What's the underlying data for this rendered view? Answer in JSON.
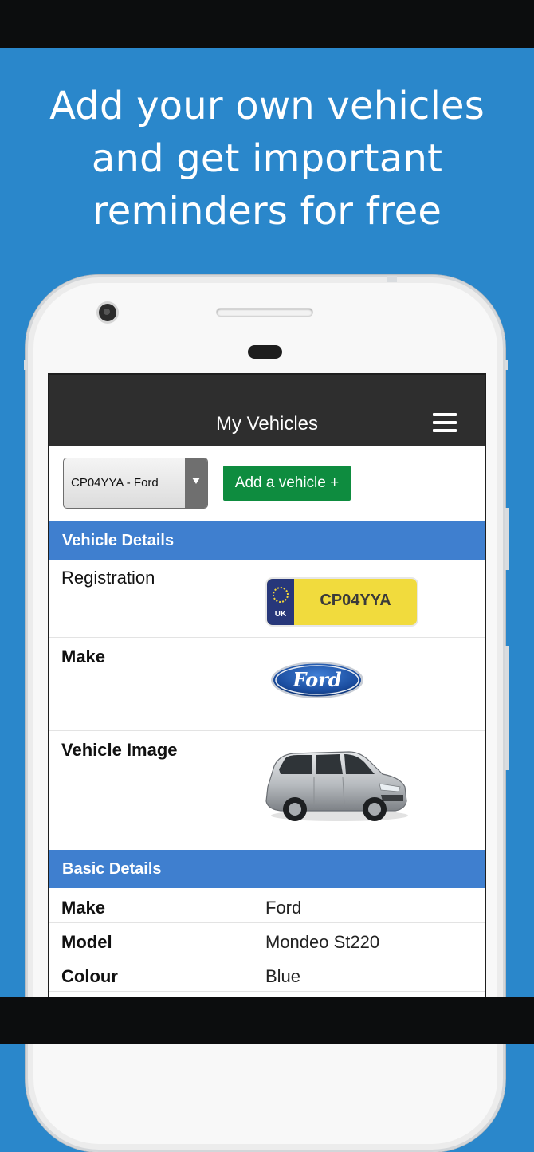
{
  "headline": {
    "line1": "Add your own vehicles",
    "line2": "and get important",
    "line3": "reminders for free"
  },
  "app": {
    "title": "My Vehicles",
    "vehicle_selector_value": "CP04YYA - Ford",
    "add_vehicle_label": "Add a vehicle +"
  },
  "vehicle_details": {
    "header": "Vehicle Details",
    "registration_label": "Registration",
    "registration_value": "CP04YYA",
    "plate_country": "UK",
    "make_label": "Make",
    "make_logo_text": "Ford",
    "image_label": "Vehicle Image"
  },
  "basic_details": {
    "header": "Basic Details",
    "rows": [
      {
        "label": "Make",
        "value": "Ford"
      },
      {
        "label": "Model",
        "value": "Mondeo St220"
      },
      {
        "label": "Colour",
        "value": "Blue"
      }
    ]
  },
  "colors": {
    "background": "#2a87cb",
    "app_bar": "#2e2e2e",
    "section_header": "#3f7fcf",
    "add_button": "#0e8c3f",
    "plate_yellow": "#f1db3d",
    "plate_blue": "#27377a"
  },
  "icons": [
    "menu-icon",
    "dropdown-arrow-icon",
    "eu-stars-icon",
    "ford-logo",
    "car-image"
  ]
}
